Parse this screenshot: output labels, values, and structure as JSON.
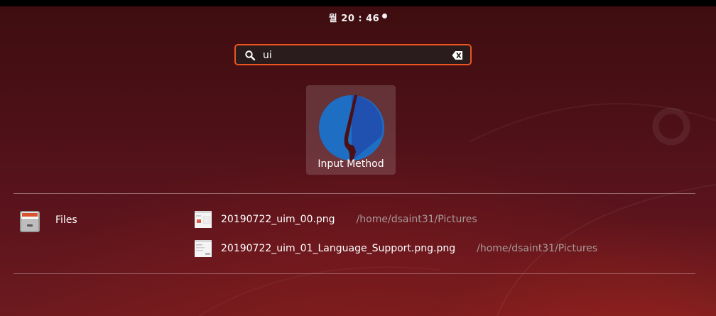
{
  "top_bar": {
    "clock": "월 20 : 46",
    "notification_dot": true
  },
  "search": {
    "value": "ui",
    "icon": "search-icon",
    "clear_icon": "edit-clear-icon",
    "accent_color": "#e95420"
  },
  "app_results": [
    {
      "label": "Input Method",
      "icon": "input-method-icon"
    }
  ],
  "file_provider": {
    "label": "Files",
    "icon": "files-cabinet-icon"
  },
  "file_results": [
    {
      "name": "20190722_uim_00.png",
      "path": "/home/dsaint31/Pictures",
      "icon": "image-thumbnail"
    },
    {
      "name": "20190722_uim_01_Language_Support.png.png",
      "path": "/home/dsaint31/Pictures",
      "icon": "image-thumbnail"
    }
  ],
  "colors": {
    "background": "#4b1016",
    "accent": "#e95420",
    "path_text": "#a89a9a"
  }
}
